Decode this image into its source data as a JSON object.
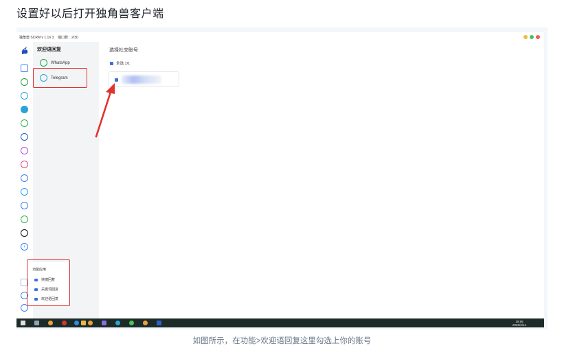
{
  "page": {
    "title": "设置好以后打开独角兽客户端",
    "caption": "如图所示，在功能>欢迎语回复这里勾选上你的账号"
  },
  "app": {
    "name": "独角兽 SCRM v 1.16.3",
    "ports": "端口数：2/30",
    "window_controls": [
      "minimize",
      "maximize",
      "close"
    ],
    "window_control_colors": [
      "#f2b93b",
      "#4cc15a",
      "#f0604d"
    ]
  },
  "sidebar": {
    "icons": [
      "unicorn-logo",
      "home",
      "whatsapp",
      "telegram",
      "telegram-plus",
      "line",
      "facebook",
      "messenger",
      "instagram",
      "zalo",
      "twitter",
      "other-chat",
      "green-chat",
      "tiktok",
      "add",
      "function-menu",
      "settings",
      "logout"
    ]
  },
  "panel": {
    "title": "欢迎语回复",
    "items": [
      {
        "label": "WhatsApp",
        "icon": "whatsapp-icon",
        "color": "#25a244"
      },
      {
        "label": "Telegram",
        "icon": "telegram-icon",
        "color": "#2aa3d9",
        "highlighted": true
      }
    ]
  },
  "main": {
    "title": "选择社交账号",
    "select_all": "全选 1/1",
    "account_checked": true
  },
  "func_menu": {
    "title": "功能应用",
    "items": [
      "快捷回复",
      "关键词回复",
      "欢迎语回复"
    ]
  },
  "taskbar": {
    "time": "18:56",
    "date": "2025/2/14"
  },
  "colors": {
    "highlight": "#e0322e",
    "accent": "#3b6fe0"
  }
}
